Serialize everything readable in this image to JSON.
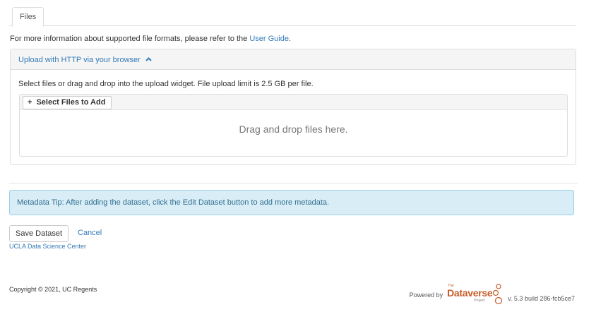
{
  "tabs": {
    "files_label": "Files"
  },
  "info": {
    "prefix": "For more information about supported file formats, please refer to the ",
    "link": "User Guide",
    "suffix": "."
  },
  "upload_panel": {
    "heading": "Upload with HTTP via your browser",
    "caret_icon": "chevron-up-icon",
    "instructions": "Select files or drag and drop into the upload widget. File upload limit is 2.5 GB per file.",
    "select_button": "Select Files to Add",
    "drop_text": "Drag and drop files here."
  },
  "alert": {
    "text": "Metadata Tip: After adding the dataset, click the Edit Dataset button to add more metadata."
  },
  "actions": {
    "save": "Save Dataset",
    "cancel": "Cancel"
  },
  "footer": {
    "center_link": "UCLA Data Science Center",
    "copyright": "Copyright © 2021, UC Regents",
    "powered_by": "Powered by",
    "logo_the": "The",
    "logo_word": "Dataverse",
    "logo_project": "Project",
    "version": "v. 5.3 build 286-fcb5ce7"
  },
  "colors": {
    "link": "#337ab7",
    "alert_bg": "#d9edf7",
    "alert_text": "#31708f",
    "logo": "#c55b28"
  }
}
